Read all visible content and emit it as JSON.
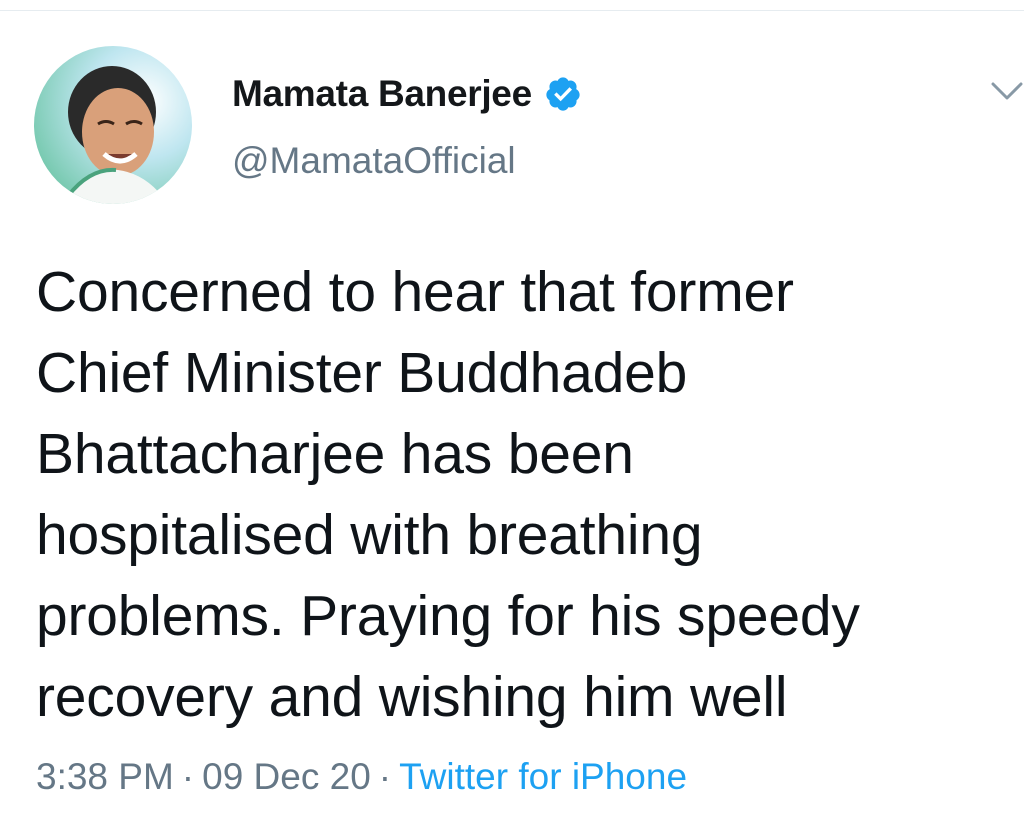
{
  "tweet": {
    "author": {
      "display_name": "Mamata Banerjee",
      "handle": "@MamataOfficial",
      "verified": true,
      "avatar_icon": "profile-photo"
    },
    "text_lines": [
      "Concerned to hear that former",
      "Chief Minister Buddhadeb",
      "Bhattacharjee has been",
      "hospitalised with breathing",
      "problems. Praying for his speedy",
      "recovery and wishing him well"
    ],
    "time": "3:38 PM",
    "date": "09 Dec 20",
    "separator": "·",
    "source": "Twitter for iPhone",
    "menu_icon": "chevron-down-icon",
    "verified_icon": "verified-badge-icon"
  },
  "colors": {
    "text": "#0f1419",
    "secondary": "#657786",
    "accent": "#1da1f2",
    "background": "#ffffff"
  }
}
